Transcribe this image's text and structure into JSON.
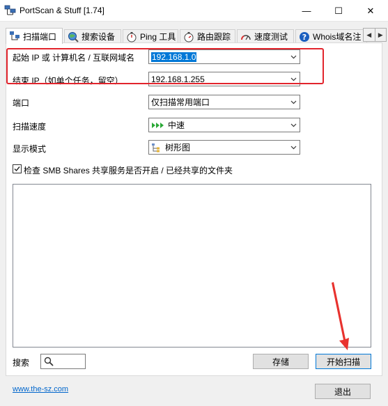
{
  "window": {
    "title": "PortScan & Stuff [1.74]",
    "minimize": "—",
    "maximize": "☐",
    "close": "✕"
  },
  "tabs": [
    {
      "label": "扫描端口",
      "icon": "network-icon",
      "active": true
    },
    {
      "label": "搜索设备",
      "icon": "globe-search-icon",
      "active": false
    },
    {
      "label": "Ping 工具",
      "icon": "stopwatch-icon",
      "active": false
    },
    {
      "label": "路由跟踪",
      "icon": "stopwatch-icon",
      "active": false
    },
    {
      "label": "速度测试",
      "icon": "speedometer-icon",
      "active": false
    },
    {
      "label": "Whois域名注",
      "icon": "question-icon",
      "active": false
    }
  ],
  "form": {
    "start_ip_label": "起始 IP 或 计算机名 / 互联网域名",
    "start_ip_value": "192.168.1.0",
    "end_ip_label": "结束 IP（如单个任务，留空）",
    "end_ip_value": "192.168.1.255",
    "port_label": "端口",
    "port_value": "仅扫描常用端口",
    "speed_label": "扫描速度",
    "speed_value": "中速",
    "display_label": "显示模式",
    "display_value": "树形图",
    "smb_checked": true,
    "smb_label": "检查 SMB Shares 共享服务是否开启 / 已经共享的文件夹"
  },
  "bottom": {
    "search_label": "搜索",
    "save_button": "存储",
    "start_button": "开始扫描",
    "website": "www.the-sz.com",
    "exit_button": "退出"
  },
  "colors": {
    "highlight_box": "#e2242c",
    "annotation_arrow": "#e8322e",
    "selection": "#0078d7"
  }
}
